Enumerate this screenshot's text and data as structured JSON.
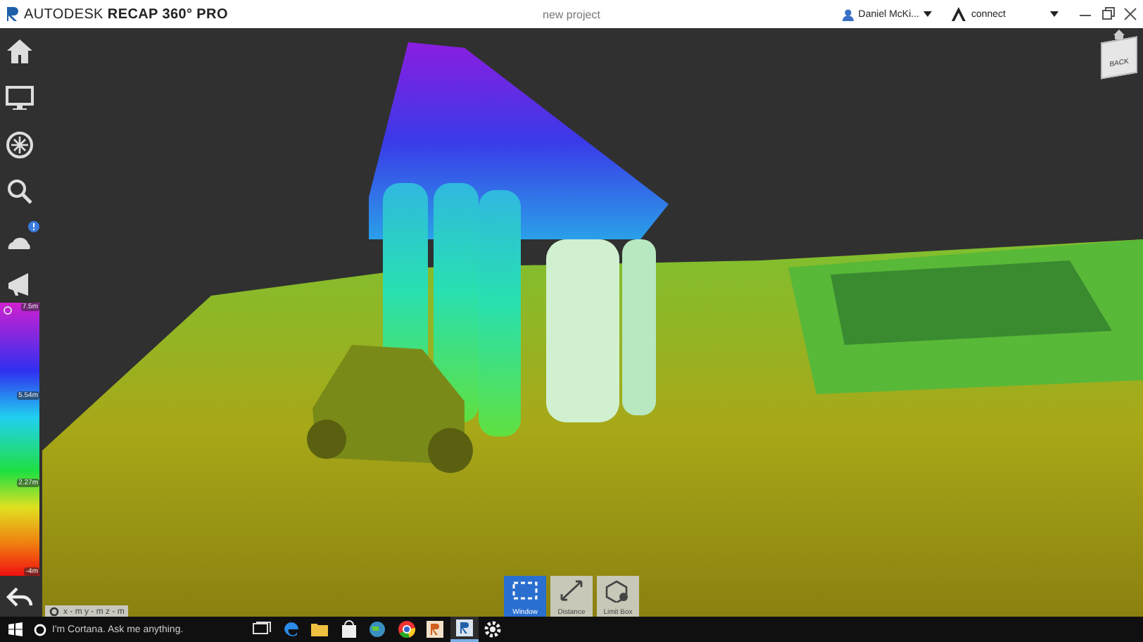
{
  "window": {
    "brand": "AUTODESK **RECAP 360° PRO**",
    "title": "new project",
    "user": "Daniel McKi...",
    "connect": "connect"
  },
  "sidebar": {
    "items": [
      {
        "kind": "home"
      },
      {
        "kind": "monitor"
      },
      {
        "kind": "compass"
      },
      {
        "kind": "search"
      },
      {
        "kind": "cloud",
        "notification": true
      },
      {
        "kind": "megaphone"
      }
    ]
  },
  "legend": {
    "labels": [
      "7.5m",
      "5.54m",
      "2.27m",
      "-4m"
    ]
  },
  "coordinates": "x - m  y - m  z - m",
  "view_cube": {
    "face": "BACK"
  },
  "tools": [
    {
      "kind": "window",
      "label": "Window",
      "selected": true
    },
    {
      "kind": "distance",
      "label": "Distance",
      "selected": false
    },
    {
      "kind": "limitbox",
      "label": "Limit Box",
      "selected": false
    }
  ],
  "taskbar": {
    "search_placeholder": "I'm Cortana. Ask me anything.",
    "apps": [
      {
        "kind": "taskview",
        "active": false
      },
      {
        "kind": "edge",
        "active": false
      },
      {
        "kind": "folder",
        "active": false
      },
      {
        "kind": "store",
        "active": false
      },
      {
        "kind": "globe",
        "active": false
      },
      {
        "kind": "chrome",
        "active": false
      },
      {
        "kind": "recap-orange",
        "active": false
      },
      {
        "kind": "recap-blue",
        "active": true
      },
      {
        "kind": "gear",
        "active": false
      }
    ]
  }
}
